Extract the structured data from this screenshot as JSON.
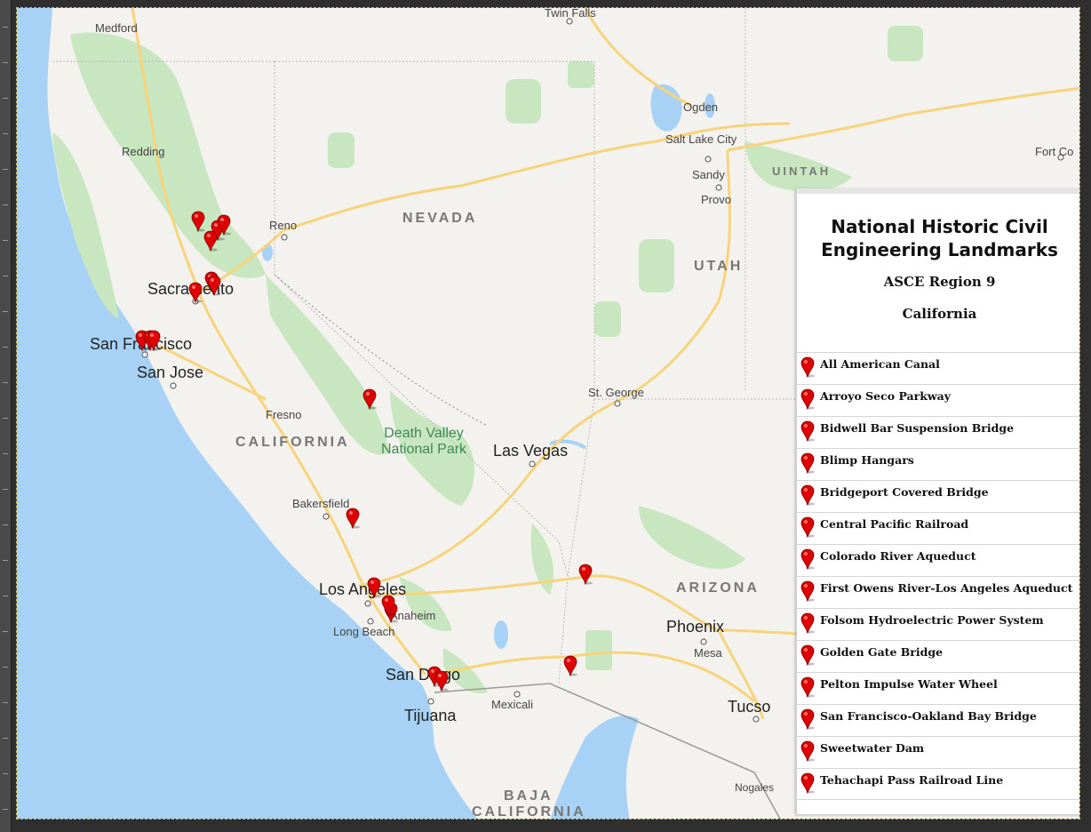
{
  "map": {
    "labels": {
      "medford": "Medford",
      "twin_falls": "Twin Falls",
      "ogden": "Ogden",
      "salt_lake_city": "Salt Lake City",
      "fort_collins": "Fort Co",
      "redding": "Redding",
      "sandy": "Sandy",
      "provo": "Provo",
      "uintah": "UINTAH",
      "nevada": "NEVADA",
      "reno": "Reno",
      "utah": "UTAH",
      "sacramento": "Sacramento",
      "san_francisco": "San Francisco",
      "san_jose": "San Jose",
      "st_george": "St. George",
      "fresno": "Fresno",
      "california": "CALIFORNIA",
      "death_valley_1": "Death Valley",
      "death_valley_2": "National Park",
      "las_vegas": "Las Vegas",
      "bakersfield": "Bakersfield",
      "los_angeles": "Los Angeles",
      "arizona": "ARIZONA",
      "anaheim": "Anaheim",
      "long_beach": "Long Beach",
      "phoenix": "Phoenix",
      "mesa": "Mesa",
      "san_diego": "San Diego",
      "tijuana": "Tijuana",
      "mexicali": "Mexicali",
      "tucson": "Tucso",
      "nogales": "Nogales",
      "baja_1": "BAJA",
      "baja_2": "CALIFORNIA"
    },
    "marker_count": 19
  },
  "legend": {
    "title": "National Historic Civil Engineering Landmarks",
    "region": "ASCE Region 9",
    "state": "California",
    "items": [
      {
        "label": "All American Canal"
      },
      {
        "label": "Arroyo Seco Parkway"
      },
      {
        "label": "Bidwell Bar Suspension Bridge"
      },
      {
        "label": "Blimp Hangars"
      },
      {
        "label": "Bridgeport Covered Bridge"
      },
      {
        "label": "Central Pacific Railroad"
      },
      {
        "label": "Colorado River Aqueduct"
      },
      {
        "label": "First Owens River-Los Angeles Aqueduct"
      },
      {
        "label": "Folsom Hydroelectric Power System"
      },
      {
        "label": "Golden Gate Bridge"
      },
      {
        "label": "Pelton Impulse Water Wheel"
      },
      {
        "label": "San Francisco-Oakland Bay Bridge"
      },
      {
        "label": "Sweetwater Dam"
      },
      {
        "label": "Tehachapi Pass Railroad Line"
      }
    ]
  },
  "colors": {
    "ocean": "#a8d2f5",
    "land": "#f4f2ee",
    "park": "#c8e6c0",
    "highway": "#f7d47a",
    "marker": "#e00000"
  },
  "icons": {
    "marker": "map-pin-icon"
  }
}
